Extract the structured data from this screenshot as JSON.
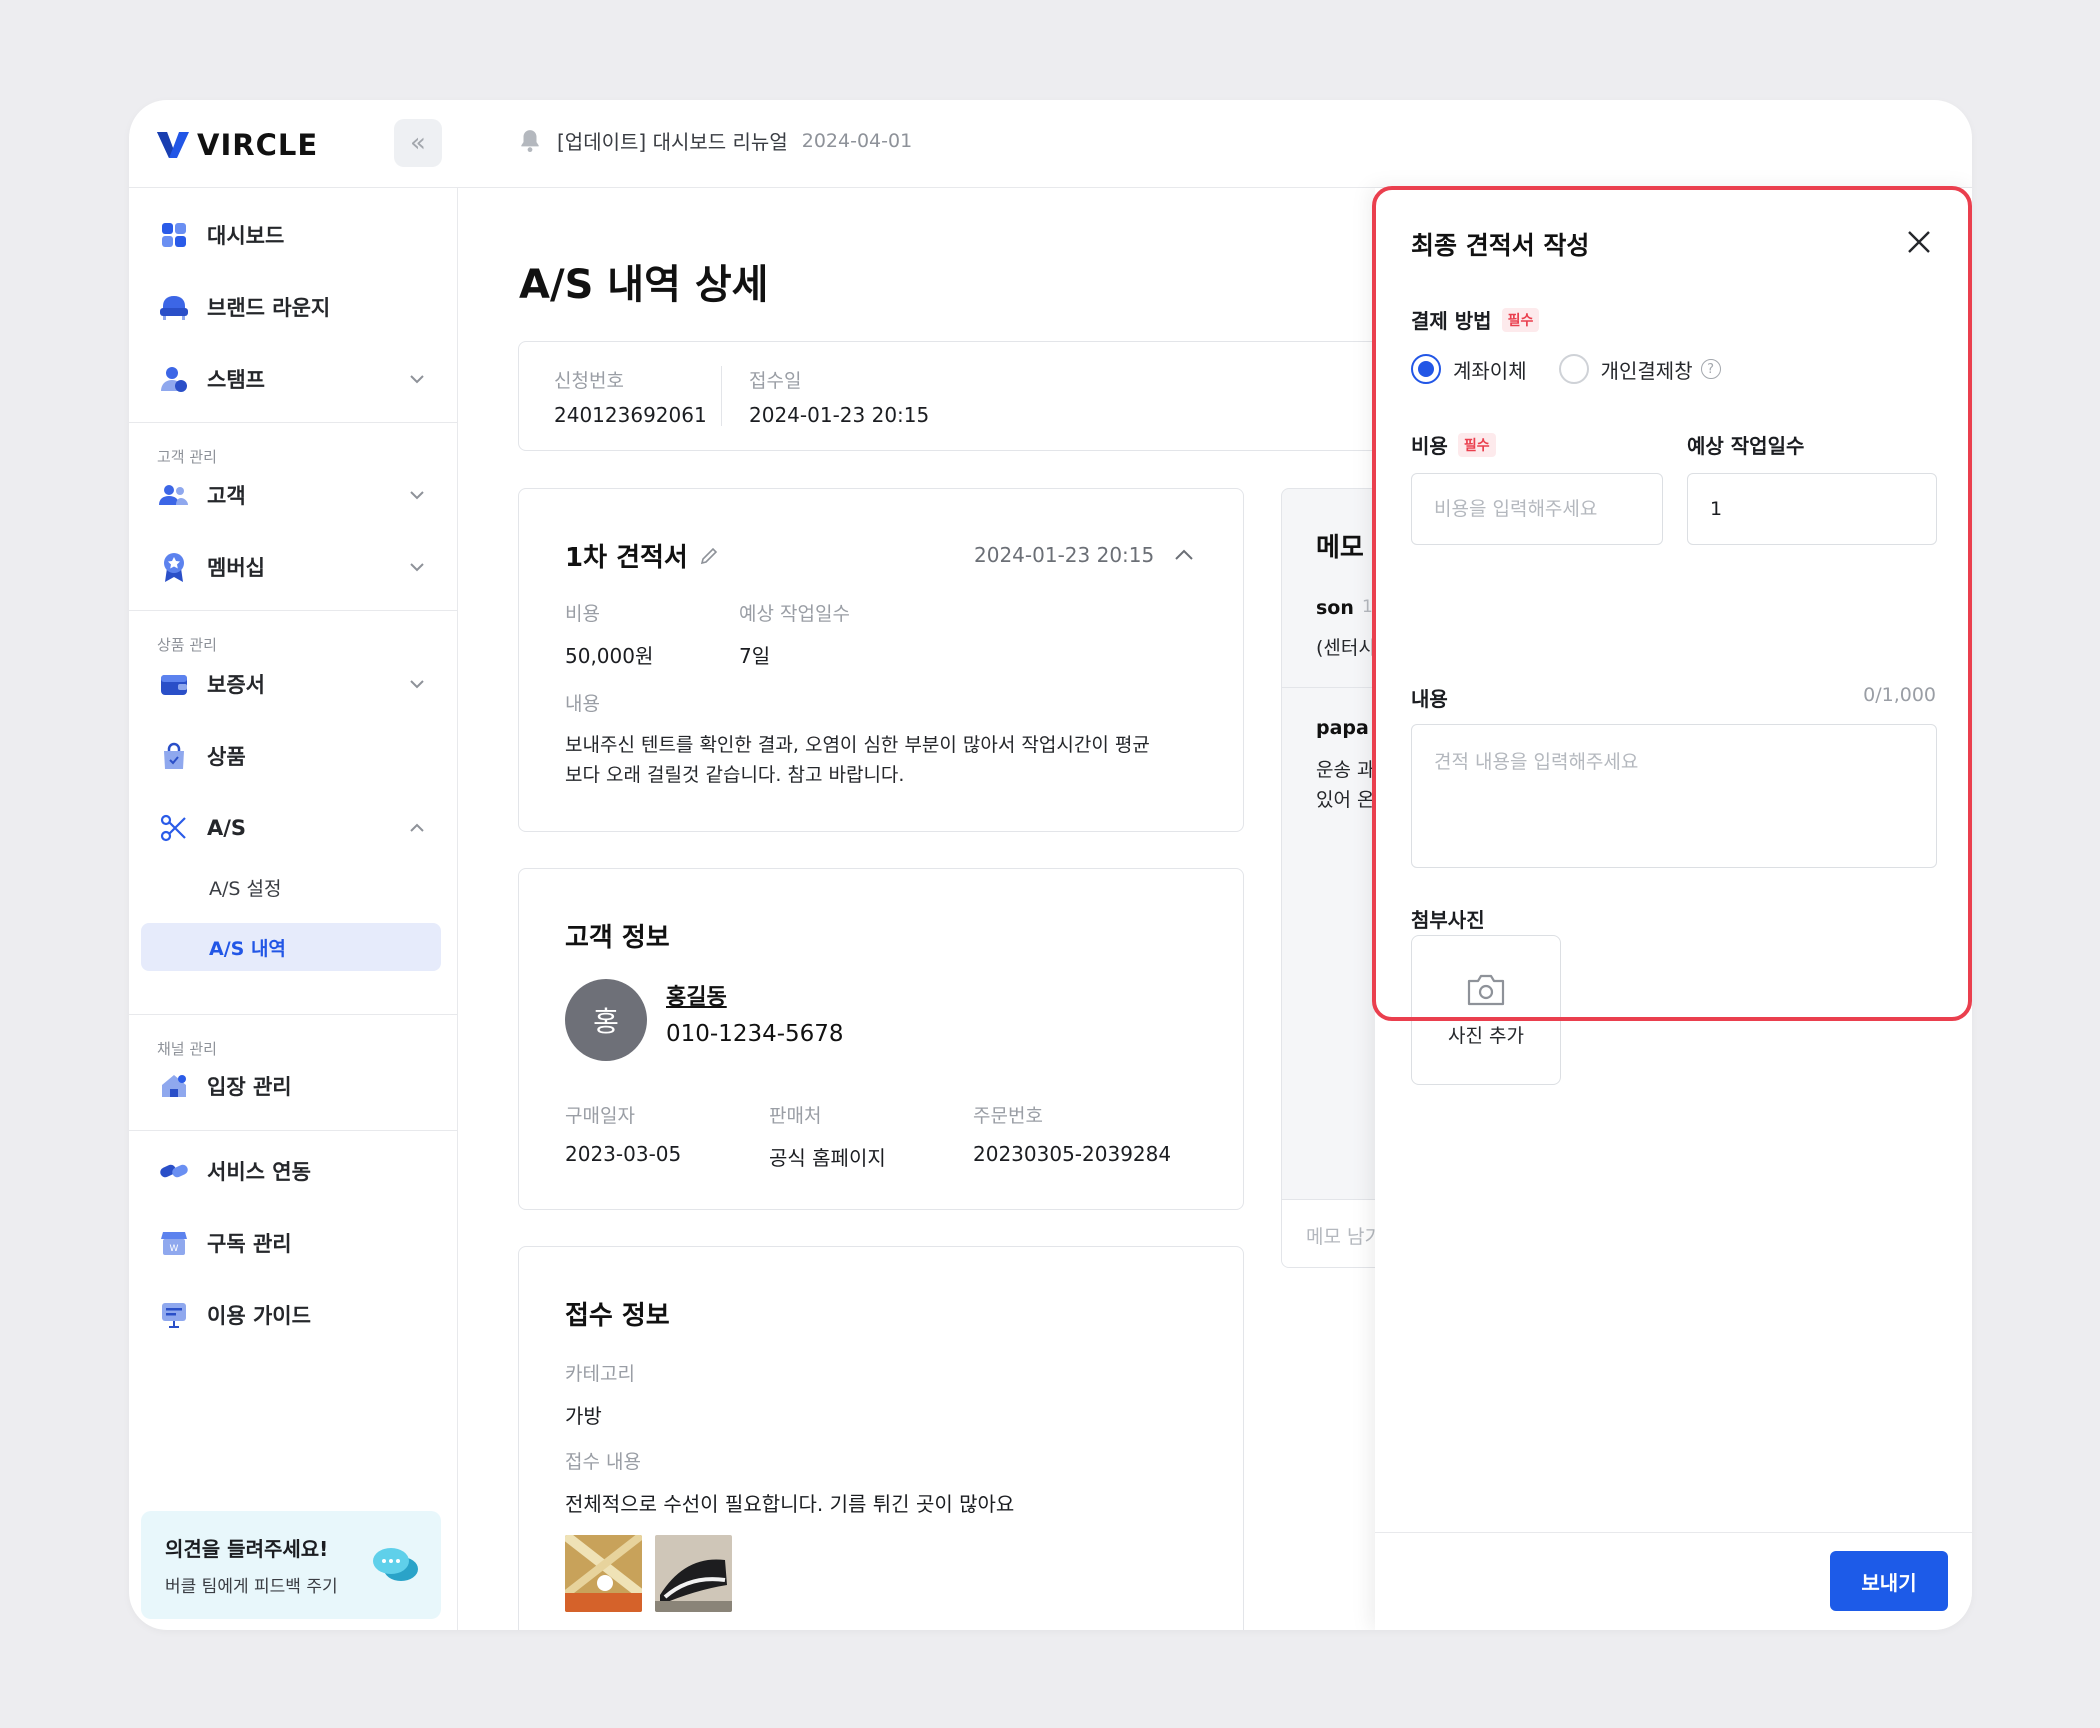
{
  "brand": {
    "name": "VIRCLE"
  },
  "notice": {
    "text": "[업데이트] 대시보드 리뉴얼",
    "date": "2024-04-01"
  },
  "sidebar": {
    "items": [
      {
        "label": "대시보드",
        "icon": "dashboard-icon"
      },
      {
        "label": "브랜드 라운지",
        "icon": "sofa-icon"
      },
      {
        "label": "스탬프",
        "icon": "user-stamp-icon"
      },
      {
        "label": "고객",
        "icon": "users-icon"
      },
      {
        "label": "멤버십",
        "icon": "badge-icon"
      },
      {
        "label": "보증서",
        "icon": "wallet-icon"
      },
      {
        "label": "상품",
        "icon": "bag-icon"
      },
      {
        "label": "A/S",
        "icon": "scissors-icon"
      },
      {
        "label": "입장 관리",
        "icon": "home-icon"
      },
      {
        "label": "서비스 연동",
        "icon": "link-icon"
      },
      {
        "label": "구독 관리",
        "icon": "shop-icon"
      },
      {
        "label": "이용 가이드",
        "icon": "guide-icon"
      }
    ],
    "sections": {
      "customer": "고객 관리",
      "product": "상품 관리",
      "channel": "채널 관리"
    },
    "sub": {
      "as_settings": "A/S 설정",
      "as_history": "A/S 내역"
    },
    "feedback": {
      "title": "의견을 들려주세요!",
      "subtitle": "버클 팀에게 피드백 주기"
    }
  },
  "page": {
    "title": "A/S 내역 상세",
    "request": {
      "no_label": "신청번호",
      "no": "240123692061",
      "date_label": "접수일",
      "date": "2024-01-23 20:15"
    }
  },
  "estimate": {
    "title": "1차 견적서",
    "date": "2024-01-23 20:15",
    "cost_label": "비용",
    "cost": "50,000원",
    "days_label": "예상 작업일수",
    "days": "7일",
    "content_label": "내용",
    "content_line1": "보내주신 텐트를 확인한 결과, 오염이 심한 부분이 많아서 작업시간이 평균",
    "content_line2": "보다 오래 걸릴것 같습니다. 참고 바랍니다."
  },
  "customer": {
    "title": "고객 정보",
    "avatar": "홍",
    "name": "홍길동",
    "phone": "010-1234-5678",
    "purchase_label": "구매일자",
    "purchase": "2023-03-05",
    "seller_label": "판매처",
    "seller": "공식 홈페이지",
    "order_label": "주문번호",
    "order": "20230305-2039284"
  },
  "reception": {
    "title": "접수 정보",
    "category_label": "카테고리",
    "category": "가방",
    "content_label": "접수 내용",
    "content": "전체적으로 수선이 필요합니다. 기름 튀긴 곳이 많아요"
  },
  "memo": {
    "title": "메모",
    "entries": [
      {
        "author": "son",
        "meta": "1",
        "text": "(센터시"
      },
      {
        "author": "papa",
        "text1": "운송 과",
        "text2": "있어 온"
      }
    ],
    "input_placeholder": "메모 남기"
  },
  "modal": {
    "title": "최종 견적서 작성",
    "payment_label": "결제 방법",
    "required": "필수",
    "payment_options": [
      "계좌이체",
      "개인결제창"
    ],
    "cost_label": "비용",
    "cost_placeholder": "비용을 입력해주세요",
    "days_label": "예상 작업일수",
    "days_value": "1",
    "content_label": "내용",
    "counter": "0/1,000",
    "content_placeholder": "견적 내용을 입력해주세요",
    "photo_label": "첨부사진",
    "photo_add": "사진 추가",
    "send": "보내기"
  },
  "colors": {
    "accent": "#1d5be8",
    "highlight": "#ea3f4e",
    "active_bg": "#e6ebfb"
  }
}
